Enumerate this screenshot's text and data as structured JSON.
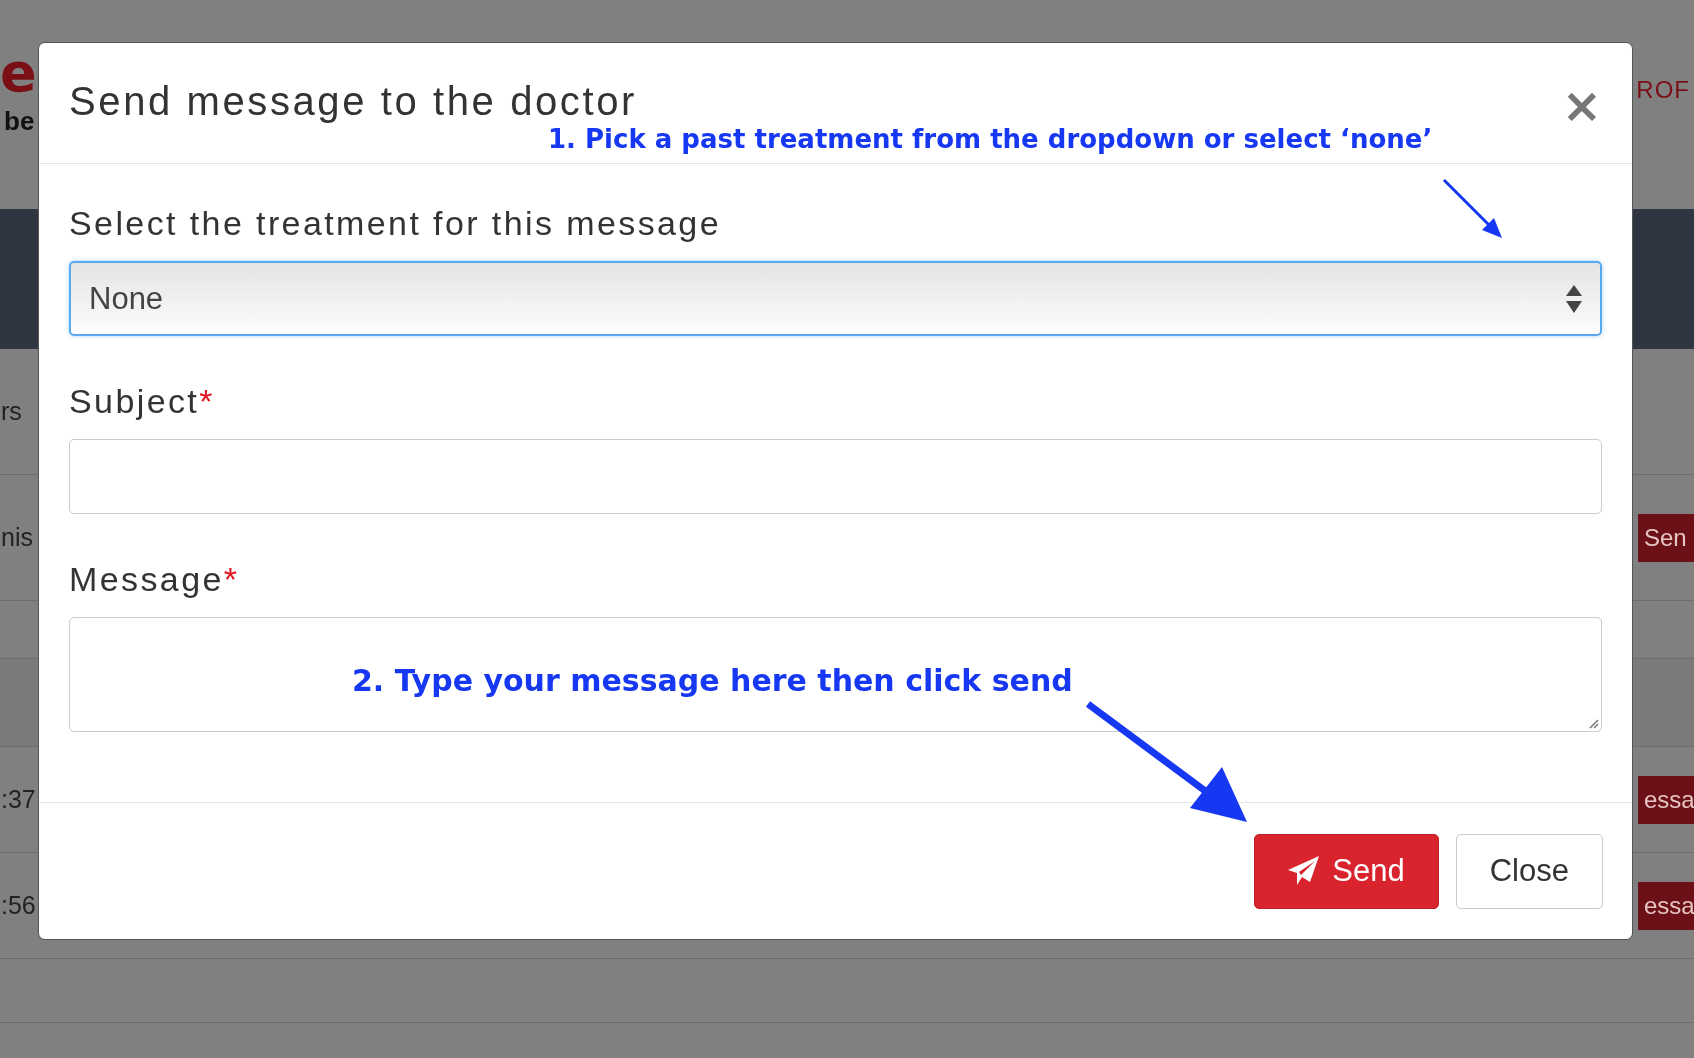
{
  "background_page": {
    "logo_fragment": "e",
    "tagline_fragment": "be",
    "nav_fragment": "ROF",
    "rows": [
      {
        "text": "rs"
      },
      {
        "text": "nis",
        "button": "Sen"
      },
      {
        "text": ":37",
        "button": "essa"
      },
      {
        "text": ":56",
        "button": "essa"
      }
    ]
  },
  "dialog": {
    "title": "Send message to the doctor",
    "close": "×",
    "fields": [
      {
        "kind": "select",
        "label": "Select the treatment for this message",
        "value": "None",
        "focused": true
      },
      {
        "kind": "input",
        "label": "Subject",
        "required": "*",
        "focused": false
      },
      {
        "kind": "textarea",
        "label": "Message",
        "required": "*",
        "focused": false
      }
    ],
    "buttons": [
      {
        "label": "Send",
        "kind": "primary"
      },
      {
        "label": "Close",
        "kind": "default"
      }
    ]
  },
  "annotations": [
    "1. Pick a past treatment from the dropdown or select ‘none’",
    "2. Type your message here then click send"
  ]
}
